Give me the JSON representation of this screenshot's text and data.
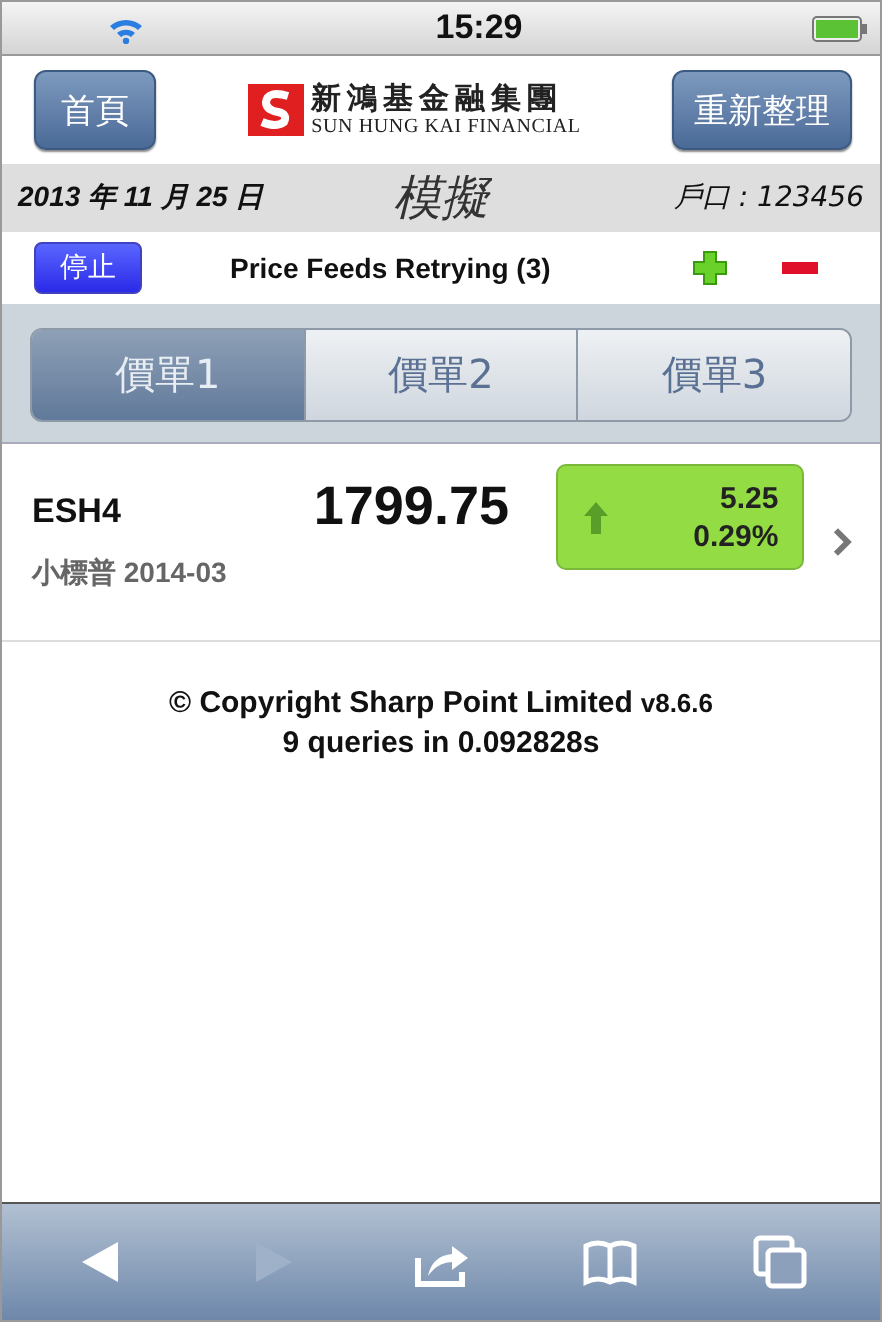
{
  "status_bar": {
    "time": "15:29"
  },
  "header": {
    "home_button": "首頁",
    "logo_chinese": "新鴻基金融集團",
    "logo_english": "SUN HUNG KAI FINANCIAL",
    "refresh_button": "重新整理"
  },
  "info_bar": {
    "date": "2013 年 11 月 25 日",
    "mode": "模擬",
    "account": "戶口 : 123456"
  },
  "feed_bar": {
    "stop_button": "停止",
    "status": "Price Feeds Retrying (3)"
  },
  "tabs": [
    {
      "label": "價單1",
      "selected": true
    },
    {
      "label": "價單2",
      "selected": false
    },
    {
      "label": "價單3",
      "selected": false
    }
  ],
  "quotes": [
    {
      "symbol": "ESH4",
      "name": "小標普 2014-03",
      "price": "1799.75",
      "change": "5.25",
      "change_percent": "0.29%",
      "rising": true
    }
  ],
  "footer": {
    "copyright": "© Copyright Sharp Point Limited",
    "version": "v8.6.6",
    "queries": "9 queries in 0.092828s"
  },
  "toolbar": {
    "buttons": [
      {
        "kind": "back",
        "disabled": false
      },
      {
        "kind": "forward",
        "disabled": true
      },
      {
        "kind": "share",
        "disabled": false
      },
      {
        "kind": "bookmarks",
        "disabled": false
      },
      {
        "kind": "pages",
        "disabled": false
      }
    ]
  }
}
